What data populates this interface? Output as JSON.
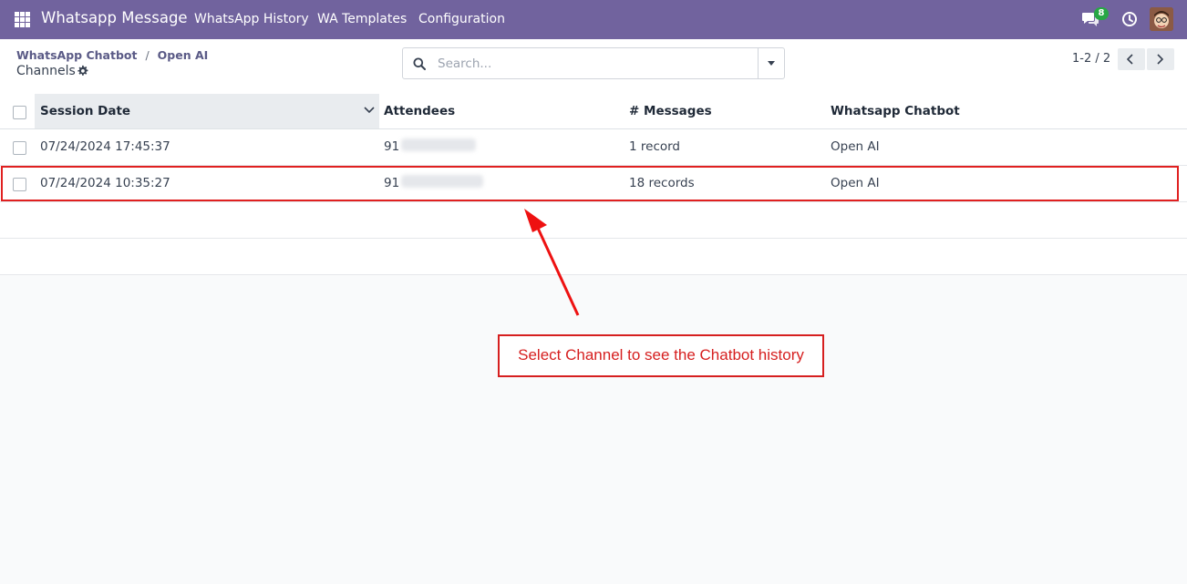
{
  "navbar": {
    "app_title": "Whatsapp Message",
    "menu": [
      "WhatsApp History",
      "WA Templates",
      "Configuration"
    ],
    "chat_badge": "8",
    "icons": [
      "apps-grid-icon",
      "chat-icon",
      "clock-icon"
    ],
    "color": "#71639e"
  },
  "breadcrumb": {
    "parent": "WhatsApp Chatbot",
    "current": "Open AI",
    "subtitle": "Channels"
  },
  "search": {
    "placeholder": "Search..."
  },
  "pager": {
    "value": "1-2 / 2"
  },
  "table": {
    "headers": [
      "Session Date",
      "Attendees",
      "# Messages",
      "Whatsapp Chatbot"
    ],
    "rows": [
      {
        "session_date": "07/24/2024 17:45:37",
        "attendees": "91",
        "messages": "1 record",
        "chatbot": "Open AI"
      },
      {
        "session_date": "07/24/2024 10:35:27",
        "attendees": "91",
        "messages": "18 records",
        "chatbot": "Open AI"
      }
    ]
  },
  "annotation": {
    "callout": "Select Channel to see the Chatbot history",
    "color": "#d61f1f"
  }
}
